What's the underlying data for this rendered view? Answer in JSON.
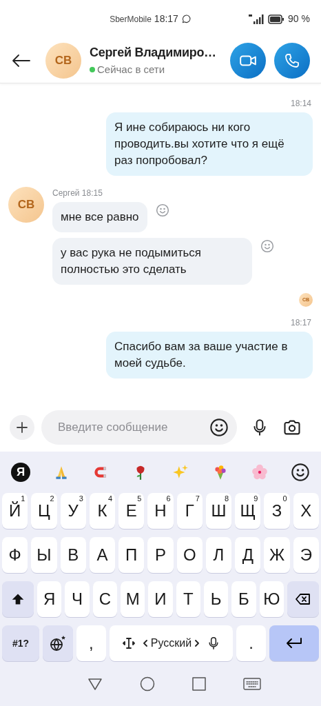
{
  "status_bar": {
    "carrier": "SberMobile",
    "time": "18:17",
    "battery": "90 %"
  },
  "header": {
    "avatar": "СВ",
    "name": "Сергей Владимиро…",
    "status": "Сейчас в сети",
    "online": true
  },
  "messages": [
    {
      "kind": "outgoing",
      "time": "18:14",
      "text": "Я ине собираюсь ни кого проводить.вы хотите что я ещё раз попробовал?"
    },
    {
      "kind": "incoming",
      "avatar": "СВ",
      "sender": "Сергей",
      "time": "18:15",
      "bubbles": [
        "мне все равно",
        "у вас рука не подымиться полностью это сделать"
      ]
    },
    {
      "kind": "read_receipt",
      "avatar": "СВ"
    },
    {
      "kind": "outgoing",
      "time": "18:17",
      "text": "Спасибо вам за ваше участие в моей судьбе."
    }
  ],
  "composer": {
    "placeholder": "Введите сообщение"
  },
  "suggestion_bar": {
    "logo": "Я"
  },
  "keyboard": {
    "rows": [
      {
        "keys": [
          {
            "kind": "letter",
            "label": "Й",
            "hint": "1"
          },
          {
            "kind": "letter",
            "label": "Ц",
            "hint": "2"
          },
          {
            "kind": "letter",
            "label": "У",
            "hint": "3"
          },
          {
            "kind": "letter",
            "label": "К",
            "hint": "4"
          },
          {
            "kind": "letter",
            "label": "Е",
            "hint": "5"
          },
          {
            "kind": "letter",
            "label": "Н",
            "hint": "6"
          },
          {
            "kind": "letter",
            "label": "Г",
            "hint": "7"
          },
          {
            "kind": "letter",
            "label": "Ш",
            "hint": "8"
          },
          {
            "kind": "letter",
            "label": "Щ",
            "hint": "9"
          },
          {
            "kind": "letter",
            "label": "З",
            "hint": "0"
          },
          {
            "kind": "letter",
            "label": "Х"
          }
        ]
      },
      {
        "keys": [
          {
            "kind": "letter",
            "label": "Ф"
          },
          {
            "kind": "letter",
            "label": "Ы"
          },
          {
            "kind": "letter",
            "label": "В"
          },
          {
            "kind": "letter",
            "label": "А"
          },
          {
            "kind": "letter",
            "label": "П"
          },
          {
            "kind": "letter",
            "label": "Р"
          },
          {
            "kind": "letter",
            "label": "О"
          },
          {
            "kind": "letter",
            "label": "Л"
          },
          {
            "kind": "letter",
            "label": "Д"
          },
          {
            "kind": "letter",
            "label": "Ж"
          },
          {
            "kind": "letter",
            "label": "Э"
          }
        ]
      },
      {
        "keys": [
          {
            "kind": "shift"
          },
          {
            "kind": "letter",
            "label": "Я"
          },
          {
            "kind": "letter",
            "label": "Ч"
          },
          {
            "kind": "letter",
            "label": "С"
          },
          {
            "kind": "letter",
            "label": "М"
          },
          {
            "kind": "letter",
            "label": "И"
          },
          {
            "kind": "letter",
            "label": "Т"
          },
          {
            "kind": "letter",
            "label": "Ь"
          },
          {
            "kind": "letter",
            "label": "Б"
          },
          {
            "kind": "letter",
            "label": "Ю"
          },
          {
            "kind": "backspace"
          }
        ]
      },
      {
        "keys": [
          {
            "kind": "symbols",
            "label": "#1?"
          },
          {
            "kind": "globe"
          },
          {
            "kind": "letter",
            "label": ","
          },
          {
            "kind": "space",
            "label": "Русский"
          },
          {
            "kind": "letter",
            "label": "."
          },
          {
            "kind": "enter"
          }
        ]
      }
    ]
  }
}
